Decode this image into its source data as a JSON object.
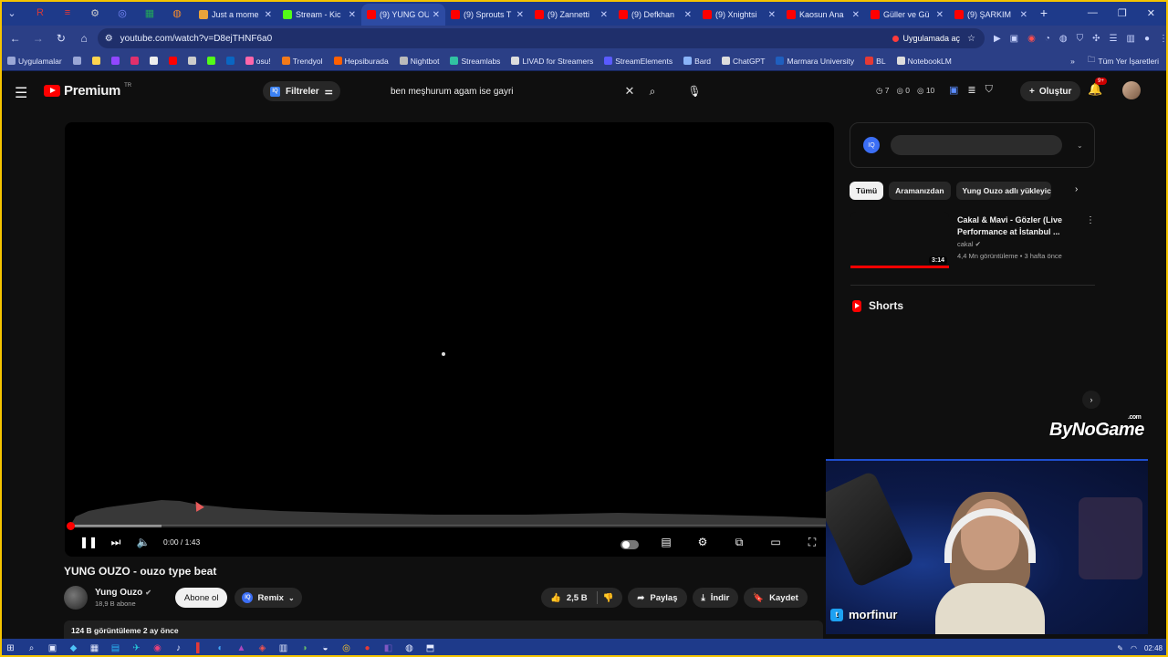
{
  "browser": {
    "pinned_tabs": [
      {
        "name": "pinned-tab-1",
        "icon": "R",
        "color": "#d43b3b"
      },
      {
        "name": "pinned-tab-2",
        "icon": "≡",
        "color": "#e53935"
      },
      {
        "name": "pinned-tab-3",
        "icon": "⚙",
        "color": "#cccccc"
      },
      {
        "name": "pinned-tab-4",
        "icon": "◎",
        "color": "#7c8cff"
      },
      {
        "name": "pinned-tab-5",
        "icon": "▦",
        "color": "#22a55b"
      },
      {
        "name": "pinned-tab-6",
        "icon": "◍",
        "color": "#f58b2b"
      }
    ],
    "tabs": [
      {
        "title": "Just a mome",
        "color": "#e8a33b",
        "active": false
      },
      {
        "title": "Stream - Kic",
        "color": "#53fc18",
        "active": false
      },
      {
        "title": "(9) YUNG OU",
        "color": "#ff0000",
        "active": true
      },
      {
        "title": "(9) Sprouts T",
        "color": "#ff0000",
        "active": false
      },
      {
        "title": "(9) Zannetti",
        "color": "#ff0000",
        "active": false
      },
      {
        "title": "(9) Defkhan",
        "color": "#ff0000",
        "active": false
      },
      {
        "title": "(9) Xnightsi",
        "color": "#ff0000",
        "active": false
      },
      {
        "title": "Kaosun Ana",
        "color": "#ff0000",
        "active": false
      },
      {
        "title": "Güller ve Gü",
        "color": "#ff0000",
        "active": false
      },
      {
        "title": "(9) ŞARKIM",
        "color": "#ff0000",
        "active": false
      }
    ],
    "url": "youtube.com/watch?v=D8ejTHNF6a0",
    "open_in_app": "Uygulamada aç",
    "bookmarks": [
      {
        "label": "Uygulamalar",
        "color": "#9aa7d6"
      },
      {
        "label": "",
        "color": "#9aa7d6"
      },
      {
        "label": "",
        "color": "#ffd54f"
      },
      {
        "label": "",
        "color": "#9147ff"
      },
      {
        "label": "",
        "color": "#e1306c"
      },
      {
        "label": "",
        "color": "#eeeeee"
      },
      {
        "label": "",
        "color": "#ff0000"
      },
      {
        "label": "",
        "color": "#cccccc"
      },
      {
        "label": "",
        "color": "#53fc18"
      },
      {
        "label": "",
        "color": "#0a66c2"
      },
      {
        "label": "osu!",
        "color": "#ff66aa"
      },
      {
        "label": "Trendyol",
        "color": "#f27a1a"
      },
      {
        "label": "Hepsiburada",
        "color": "#ff6000"
      },
      {
        "label": "Nightbot",
        "color": "#bbbbbb"
      },
      {
        "label": "Streamlabs",
        "color": "#31c3a2"
      },
      {
        "label": "LIVAD for Streamers",
        "color": "#dddddd"
      },
      {
        "label": "StreamElements",
        "color": "#5a5bff"
      },
      {
        "label": "Bard",
        "color": "#8ab4f8"
      },
      {
        "label": "ChatGPT",
        "color": "#dddddd"
      },
      {
        "label": "Marmara University",
        "color": "#1f5fbf"
      },
      {
        "label": "BL",
        "color": "#e53935"
      },
      {
        "label": "NotebookLM",
        "color": "#dddddd"
      }
    ],
    "all_bookmarks": "Tüm Yer İşaretleri"
  },
  "youtube": {
    "logo_text": "Premium",
    "logo_region": "TR",
    "filters_label": "Filtreler",
    "search_query": "ben meşhurum agam ise gayri",
    "stats": [
      "7",
      "0",
      "10"
    ],
    "create_label": "Oluştur",
    "notif_count": "9+"
  },
  "player": {
    "time": "0:00 / 1:43",
    "progress_fraction": 0.0,
    "buffered_fraction": 0.12
  },
  "video": {
    "title": "YUNG OUZO - ouzo type beat",
    "channel": "Yung Ouzo",
    "subscribers": "18,9 B abone",
    "subscribe_label": "Abone ol",
    "remix_label": "Remix",
    "likes": "2,5 B",
    "share_label": "Paylaş",
    "download_label": "İndir",
    "save_label": "Kaydet",
    "views_date": "124 B görüntüleme  2 ay önce"
  },
  "sidebar": {
    "chips": [
      "Tümü",
      "Aramanızdan",
      "Yung Ouzo adlı yükleyici"
    ],
    "recommendation": {
      "title": "Cakal & Mavi - Gözler (Live Performance at İstanbul ...",
      "channel": "cakal",
      "meta": "4,4 Mn görüntüleme • 3 hafta önce",
      "duration": "3:14"
    },
    "shorts_label": "Shorts"
  },
  "overlay": {
    "brand": "ByNoGame",
    "brand_suffix": ".com",
    "twitch_handle": "morfinur"
  },
  "taskbar": {
    "time": "02:48"
  }
}
